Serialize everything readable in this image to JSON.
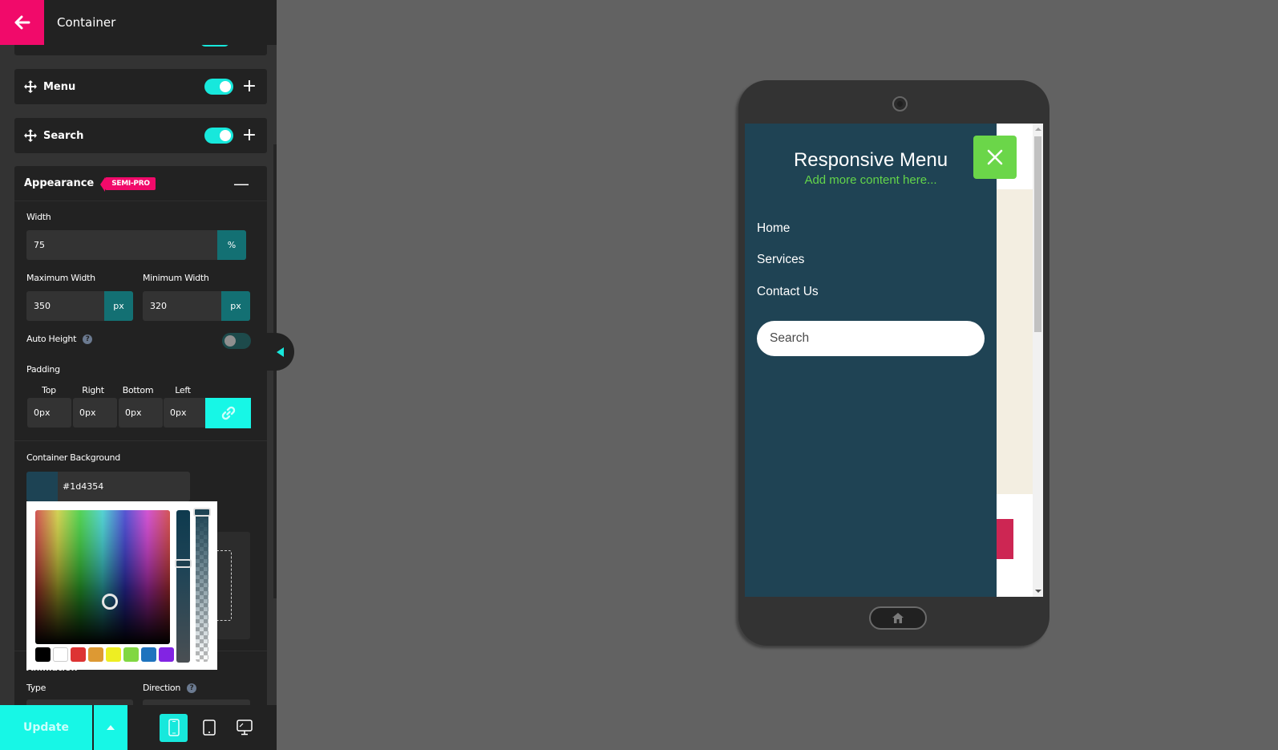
{
  "topbar": {
    "title": "Container",
    "back_icon": "arrow-left-icon"
  },
  "panels": {
    "menu": {
      "label": "Menu",
      "enabled": true
    },
    "search": {
      "label": "Search",
      "enabled": true
    },
    "appearance": {
      "label": "Appearance",
      "badge": "SEMI-PRO"
    }
  },
  "appearance": {
    "width": {
      "label": "Width",
      "value": "75",
      "unit": "%"
    },
    "max_width": {
      "label": "Maximum Width",
      "value": "350",
      "unit": "px"
    },
    "min_width": {
      "label": "Minimum Width",
      "value": "320",
      "unit": "px"
    },
    "auto_height": {
      "label": "Auto Height",
      "help": "?",
      "enabled": false
    },
    "padding": {
      "label": "Padding",
      "sides": [
        {
          "label": "Top",
          "value": "0px"
        },
        {
          "label": "Right",
          "value": "0px"
        },
        {
          "label": "Bottom",
          "value": "0px"
        },
        {
          "label": "Left",
          "value": "0px"
        }
      ],
      "linked": true
    },
    "container_background": {
      "label": "Container Background",
      "value": "#1d4354"
    }
  },
  "color_picker": {
    "swatches": [
      "#000000",
      "#ffffff",
      "#dd3333",
      "#dd9933",
      "#eeee22",
      "#81d742",
      "#1e73be",
      "#8224e3"
    ]
  },
  "animation": {
    "section_label": "Animation",
    "type_label": "Type",
    "direction_label": "Direction",
    "direction_help": "?"
  },
  "bottombar": {
    "update_label": "Update",
    "devices": [
      "mobile",
      "tablet",
      "desktop"
    ],
    "active_device": "mobile"
  },
  "preview": {
    "menu_title": "Responsive Menu",
    "menu_subtitle": "Add more content here...",
    "menu_items": [
      "Home",
      "Services",
      "Contact Us"
    ],
    "search_placeholder": "Search",
    "colors": {
      "menu_bg": "#1f4354",
      "subtitle": "#63d54a",
      "close_button": "#6bd649",
      "accent": "#17f7e6",
      "brand": "#f10a6a"
    }
  }
}
